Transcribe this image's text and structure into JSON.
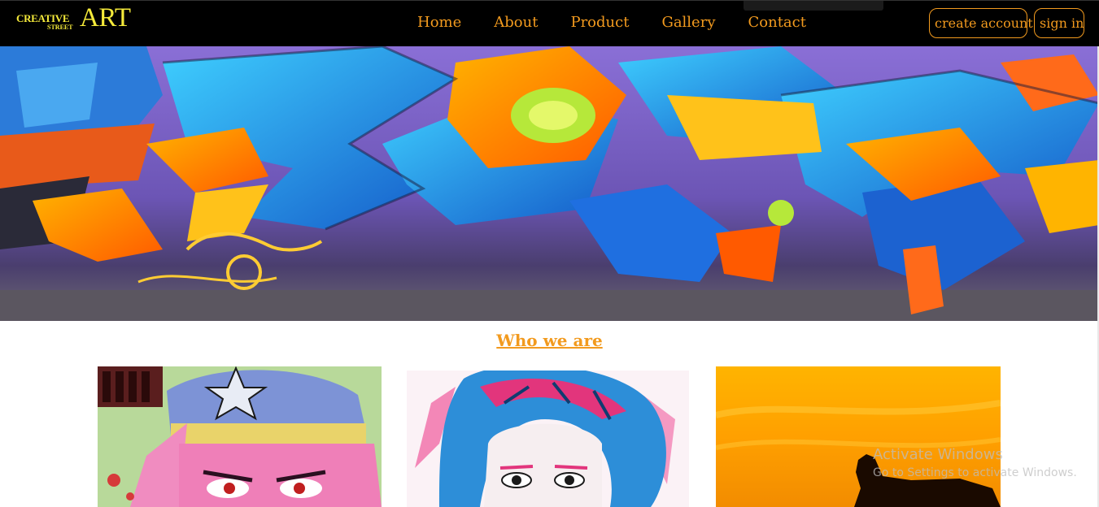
{
  "logo": {
    "line1": "CREATIVE",
    "line2": "STREET",
    "big": "ART"
  },
  "nav": {
    "links": [
      {
        "label": "Home"
      },
      {
        "label": "About"
      },
      {
        "label": "Product"
      },
      {
        "label": "Gallery"
      },
      {
        "label": "Contact"
      }
    ],
    "create_account_label": "create account",
    "sign_in_label": "sign in"
  },
  "section": {
    "title": "Who we are"
  },
  "watermark": {
    "title": "Activate Windows",
    "subtitle": "Go to Settings to activate Windows."
  },
  "colors": {
    "accent": "#f29a1e",
    "logo": "#f5ea3a",
    "nav_bg": "#000000"
  }
}
